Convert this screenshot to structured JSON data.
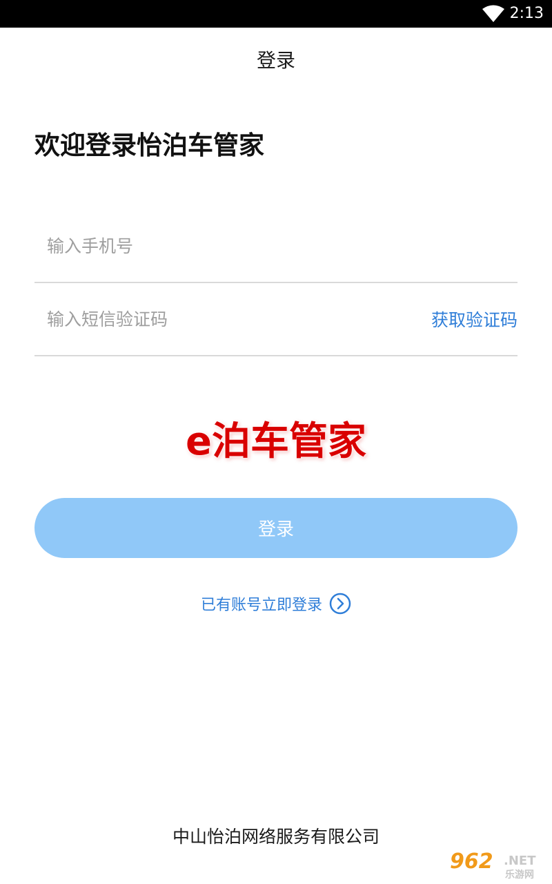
{
  "status_bar": {
    "time": "2:13",
    "wifi_icon": "wifi-icon"
  },
  "header": {
    "title": "登录"
  },
  "main": {
    "welcome": "欢迎登录怡泊车管家",
    "phone_input": {
      "placeholder": "输入手机号",
      "value": ""
    },
    "code_input": {
      "placeholder": "输入短信验证码",
      "value": ""
    },
    "get_code_label": "获取验证码",
    "watermark": "e泊车管家",
    "login_button_label": "登录",
    "existing_account_link": "已有账号立即登录",
    "existing_account_icon": "chevron-right-circle-icon"
  },
  "footer": {
    "company": "中山怡泊网络服务有限公司"
  },
  "site_logo": {
    "number": "962",
    "net": ".NET",
    "name": "乐游网"
  },
  "colors": {
    "accent": "#2f7ed8",
    "button_bg": "#90c8f8",
    "watermark": "#d90000",
    "status_bar": "#000000"
  }
}
